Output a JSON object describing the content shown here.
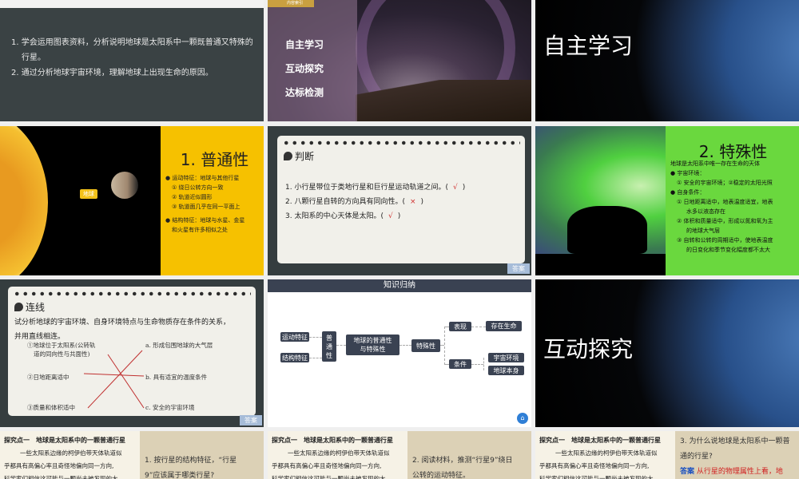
{
  "slide1": {
    "items": [
      "1.  学会运用图表资料，分析说明地球是太阳系中一颗既普通又特殊的",
      "行星。",
      "2.  通过分析地球宇宙环境，理解地球上出现生命的原因。"
    ]
  },
  "slide2": {
    "badge": "内容索引",
    "menu": [
      "自主学习",
      "互动探究",
      "达标检测"
    ]
  },
  "slide3": {
    "title": "自主学习"
  },
  "slide4": {
    "earth_label": "地球",
    "title": "1. 普通性",
    "lines": [
      "● 运动特征：地球与其他行星",
      "① 绕日公转方向一致",
      "② 轨道近似圆形",
      "③ 轨道面几乎在同一平面上",
      "● 结构特征：地球与水星、金星",
      "和火星有许多相似之处"
    ]
  },
  "slide5": {
    "title": "判断",
    "questions": [
      {
        "text": "1. 小行星带位于类地行星和巨行星运动轨道之间。(",
        "mark": "√"
      },
      {
        "text": "2. 八颗行星自转的方向具有同向性。(",
        "mark": "×"
      },
      {
        "text": "3. 太阳系的中心天体是太阳。(",
        "mark": "√"
      }
    ],
    "close": ")",
    "answer": "答案",
    "colors": {
      "mark": "#d0302f"
    }
  },
  "slide6": {
    "title": "2. 特殊性",
    "lines": [
      "地球是太阳系中唯一存在生命的天体",
      "● 宇宙环境：",
      "① 安全的宇宙环境；②稳定的太阳光照",
      "● 自身条件：",
      "① 日地距离适中，地表温度适宜，地表",
      "水多以液态存在",
      "② 体积和质量适中，形成以氮和氧为主",
      "的地球大气层",
      "③ 自转和公转的周期适中，使地表温度",
      "的日变化和季节变化幅度都不太大"
    ]
  },
  "slide7": {
    "title": "连线",
    "prompt": [
      "试分析地球的宇宙环境、自身环境特点与生命物质存在条件的关系，",
      "并用直线相连。"
    ],
    "left": [
      "①地球位于太阳系(公转轨",
      "道的同向性与共面性)",
      "②日地距离适中",
      "③质量和体积适中"
    ],
    "right": [
      "a. 形成包围地球的大气层",
      "b. 具有适宜的温度条件",
      "c. 安全的宇宙环境"
    ],
    "answer": "答案"
  },
  "slide8": {
    "header": "知识归纳",
    "nodes": {
      "motion": "运动特征",
      "structure": "结构特征",
      "common": "普通性",
      "center_1": "地球的普通性",
      "center_2": "与特殊性",
      "special": "特殊性",
      "show": "表现",
      "life": "存在生命",
      "cond": "条件",
      "cosmic": "宇宙环境",
      "self": "地球本身"
    }
  },
  "slide9": {
    "title": "互动探究"
  },
  "row4": {
    "heading": "探究点一　地球是太阳系中的一颗普通行星",
    "para": [
      "一些太阳系边缘的柯伊伯带天体轨道似",
      "乎都具有高偏心率且奇怪地偏向同一方向,",
      "科学家们相信这可能与一颗尚未被发现的大"
    ],
    "q1": [
      "1. 按行星的结构特征，“行星",
      "9”应该属于哪类行星?"
    ],
    "q2": [
      "2. 阅读材料，推测“行星9”绕日",
      "公转的运动特征。"
    ],
    "q3": [
      "3. 为什么说地球是太阳系中一颗普",
      "通的行星?"
    ],
    "answer_label": "答案",
    "answer_text": "从行星的物理属性上看，地"
  }
}
